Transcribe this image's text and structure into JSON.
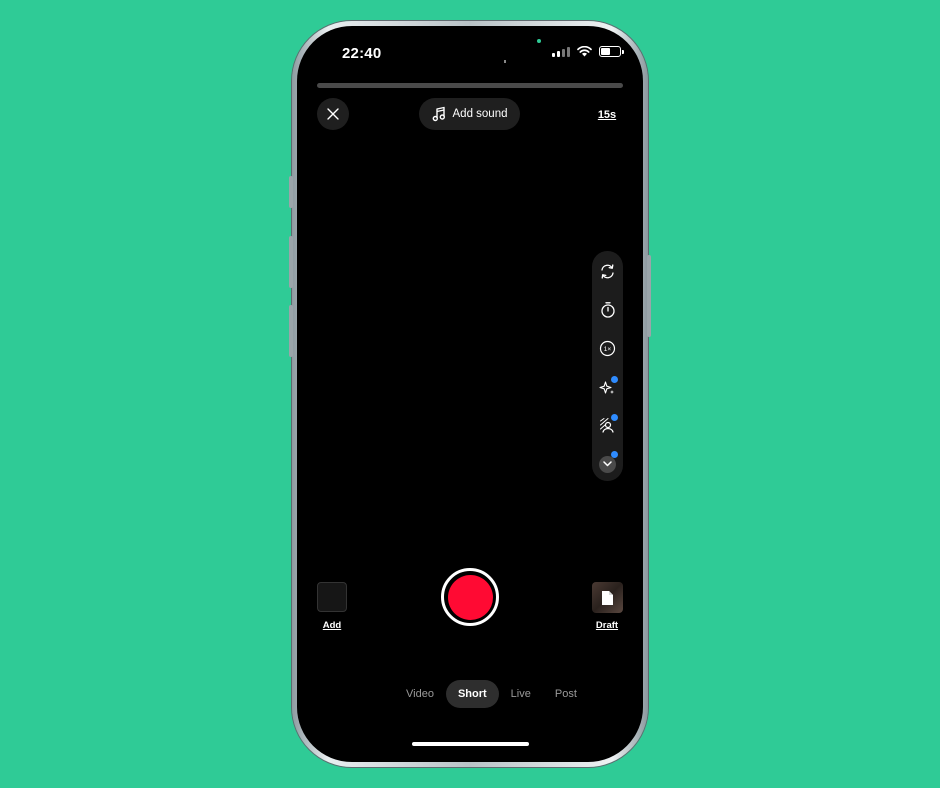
{
  "status": {
    "time": "22:40"
  },
  "recording": {
    "progress": 0.0
  },
  "header": {
    "add_sound_label": "Add sound",
    "duration_label": "15s"
  },
  "toolbar": {
    "icons": [
      "flip-camera-icon",
      "timer-icon",
      "speed-icon",
      "effects-icon",
      "green-screen-icon",
      "chevron-down-icon"
    ]
  },
  "bottom": {
    "add_label": "Add",
    "draft_label": "Draft"
  },
  "modes": {
    "items": [
      "Video",
      "Short",
      "Live",
      "Post"
    ],
    "selected": "Short"
  },
  "colors": {
    "background": "#2fcb96",
    "record": "#ff0a33",
    "badge": "#2f8cff"
  }
}
